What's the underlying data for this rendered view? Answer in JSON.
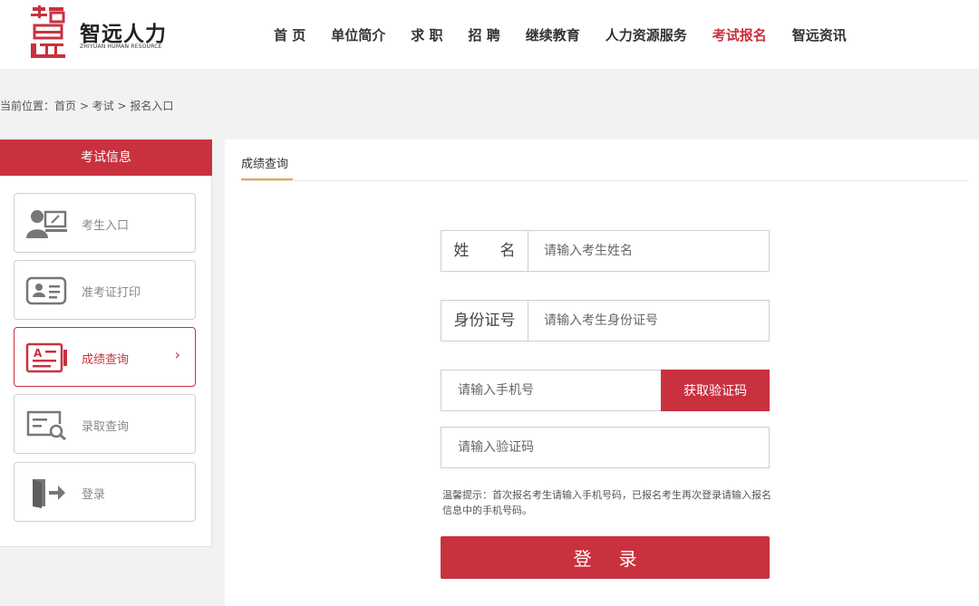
{
  "brand": {
    "name_cn": "智远人力",
    "name_en": "ZHIYUAN HUMAN RESOURCE",
    "color": "#c9313f"
  },
  "nav": {
    "items": [
      {
        "label": "首 页",
        "active": false
      },
      {
        "label": "单位简介",
        "active": false
      },
      {
        "label": "求 职",
        "active": false
      },
      {
        "label": "招 聘",
        "active": false
      },
      {
        "label": "继续教育",
        "active": false
      },
      {
        "label": "人力资源服务",
        "active": false
      },
      {
        "label": "考试报名",
        "active": true
      },
      {
        "label": "智远资讯",
        "active": false
      }
    ]
  },
  "breadcrumb": {
    "text": "当前位置：首页 > 考试 > 报名入口"
  },
  "sidebar": {
    "title": "考试信息",
    "items": [
      {
        "label": "考生入口",
        "icon": "candidate-icon",
        "active": false
      },
      {
        "label": "准考证打印",
        "icon": "id-card-icon",
        "active": false
      },
      {
        "label": "成绩查询",
        "icon": "score-icon",
        "active": true,
        "arrow": "›"
      },
      {
        "label": "录取查询",
        "icon": "search-document-icon",
        "active": false
      },
      {
        "label": "登录",
        "icon": "login-door-icon",
        "active": false
      }
    ]
  },
  "main": {
    "tab_label": "成绩查询",
    "form": {
      "name_label": "姓　　名",
      "name_placeholder": "请输入考生姓名",
      "id_label": "身份证号",
      "id_placeholder": "请输入考生身份证号",
      "phone_placeholder": "请输入手机号",
      "code_button": "获取验证码",
      "code_placeholder": "请输入验证码",
      "tip": "温馨提示：首次报名考生请输入手机号码，已报名考生再次登录请输入报名信息中的手机号码。",
      "login_button": "登录"
    }
  }
}
